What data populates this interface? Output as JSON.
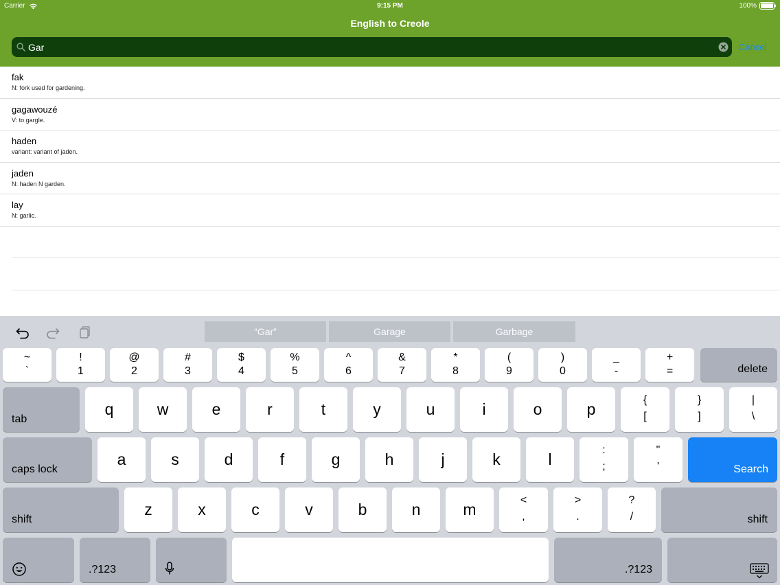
{
  "status_bar": {
    "carrier": "Carrier",
    "time": "9:15 PM",
    "battery": "100%"
  },
  "nav": {
    "title": "English to Creole"
  },
  "search": {
    "value": "Gar",
    "cancel_label": "Cancel"
  },
  "results": [
    {
      "word": "fak",
      "definition": "N:  fork used for gardening."
    },
    {
      "word": "gagawouzé",
      "definition": "V:  to gargle."
    },
    {
      "word": "haden",
      "definition": "variant:  variant of jaden."
    },
    {
      "word": "jaden",
      "definition": "N:  haden N garden."
    },
    {
      "word": "lay",
      "definition": "N:  garlic."
    }
  ],
  "keyboard": {
    "suggestions": [
      "“Gar”",
      "Garage",
      "Garbage"
    ],
    "number_row": [
      {
        "top": "~",
        "bottom": "`"
      },
      {
        "top": "!",
        "bottom": "1"
      },
      {
        "top": "@",
        "bottom": "2"
      },
      {
        "top": "#",
        "bottom": "3"
      },
      {
        "top": "$",
        "bottom": "4"
      },
      {
        "top": "%",
        "bottom": "5"
      },
      {
        "top": "^",
        "bottom": "6"
      },
      {
        "top": "&",
        "bottom": "7"
      },
      {
        "top": "*",
        "bottom": "8"
      },
      {
        "top": "(",
        "bottom": "9"
      },
      {
        "top": ")",
        "bottom": "0"
      },
      {
        "top": "_",
        "bottom": "-"
      },
      {
        "top": "+",
        "bottom": "="
      }
    ],
    "delete_label": "delete",
    "tab_label": "tab",
    "row_q": [
      "q",
      "w",
      "e",
      "r",
      "t",
      "y",
      "u",
      "i",
      "o",
      "p"
    ],
    "row_q_symbols": [
      {
        "top": "{",
        "bottom": "["
      },
      {
        "top": "}",
        "bottom": "]"
      },
      {
        "top": "|",
        "bottom": "\\"
      }
    ],
    "caps_label": "caps lock",
    "row_a": [
      "a",
      "s",
      "d",
      "f",
      "g",
      "h",
      "j",
      "k",
      "l"
    ],
    "row_a_symbols": [
      {
        "top": ":",
        "bottom": ";"
      },
      {
        "top": "\"",
        "bottom": "'"
      }
    ],
    "search_label": "Search",
    "shift_label": "shift",
    "row_z": [
      "z",
      "x",
      "c",
      "v",
      "b",
      "n",
      "m"
    ],
    "row_z_symbols": [
      {
        "top": "<",
        "bottom": ","
      },
      {
        "top": ">",
        "bottom": "."
      },
      {
        "top": "?",
        "bottom": "/"
      }
    ],
    "numbers_label": ".?123"
  },
  "colors": {
    "header": "#6da22b",
    "search_field": "#0f3f0b",
    "cancel": "#1e8be6",
    "search_key": "#1682f5",
    "keyboard_bg": "#d2d5db"
  }
}
